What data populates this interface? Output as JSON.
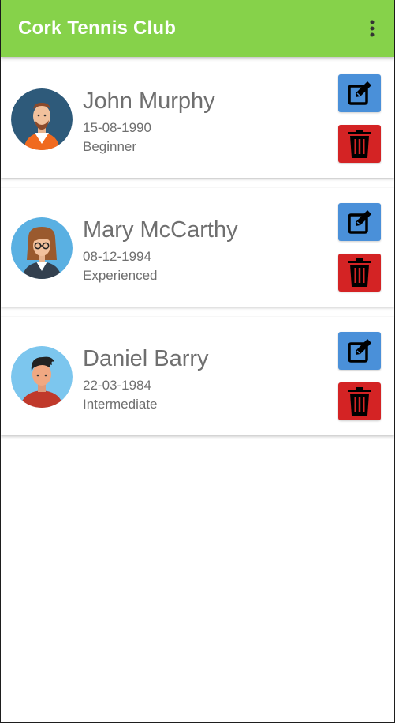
{
  "app": {
    "title": "Cork Tennis Club",
    "menu_icon": "more-vert-icon"
  },
  "members": [
    {
      "name": "John Murphy",
      "dob": "15-08-1990",
      "level": "Beginner",
      "avatar": "bearded-man-avatar"
    },
    {
      "name": "Mary McCarthy",
      "dob": "08-12-1994",
      "level": "Experienced",
      "avatar": "woman-with-glasses-avatar"
    },
    {
      "name": "Daniel Barry",
      "dob": "22-03-1984",
      "level": "Intermediate",
      "avatar": "young-man-avatar"
    }
  ],
  "actions": {
    "edit_icon": "edit-icon",
    "delete_icon": "trash-icon"
  },
  "colors": {
    "appbar": "#86d24a",
    "edit_button": "#4a90d9",
    "delete_button": "#d42324",
    "text": "#6f6f6f"
  }
}
